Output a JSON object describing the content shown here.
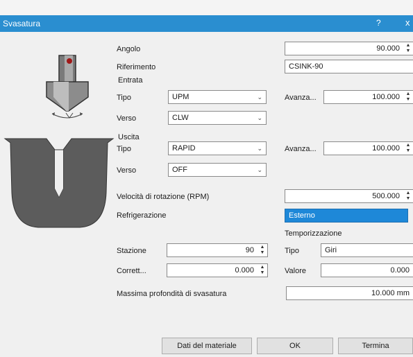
{
  "window": {
    "title": "Svasatura",
    "help_icon": "?",
    "close_icon": "x"
  },
  "angolo": {
    "label": "Angolo",
    "value": "90.000"
  },
  "riferimento": {
    "label": "Riferimento",
    "value": "CSINK-90"
  },
  "entrata": {
    "group_label": "Entrata",
    "tipo_label": "Tipo",
    "tipo_value": "UPM",
    "verso_label": "Verso",
    "verso_value": "CLW",
    "avanza_label": "Avanza...",
    "avanza_value": "100.000"
  },
  "uscita": {
    "group_label": "Uscita",
    "tipo_label": "Tipo",
    "tipo_value": "RAPID",
    "verso_label": "Verso",
    "verso_value": "OFF",
    "avanza_label": "Avanza...",
    "avanza_value": "100.000"
  },
  "velocita": {
    "label": "Velocità di rotazione (RPM)",
    "value": "500.000"
  },
  "refrigerazione": {
    "label": "Refrigerazione",
    "value": "Esterno"
  },
  "temporizzazione": {
    "group_label": "Temporizzazione",
    "tipo_label": "Tipo",
    "tipo_value": "Giri",
    "valore_label": "Valore",
    "valore_value": "0.000"
  },
  "stazione": {
    "label": "Stazione",
    "value": "90"
  },
  "correttore": {
    "label": "Corrett...",
    "value": "0.000"
  },
  "profondita": {
    "label": "Massima profondità di svasatura",
    "value": "10.000 mm"
  },
  "buttons": {
    "material": "Dati del materiale",
    "ok": "OK",
    "cancel": "Termina"
  },
  "colors": {
    "titlebar": "#2a8ed0",
    "selection": "#1e88d8",
    "tool_tip": "#a01818"
  }
}
